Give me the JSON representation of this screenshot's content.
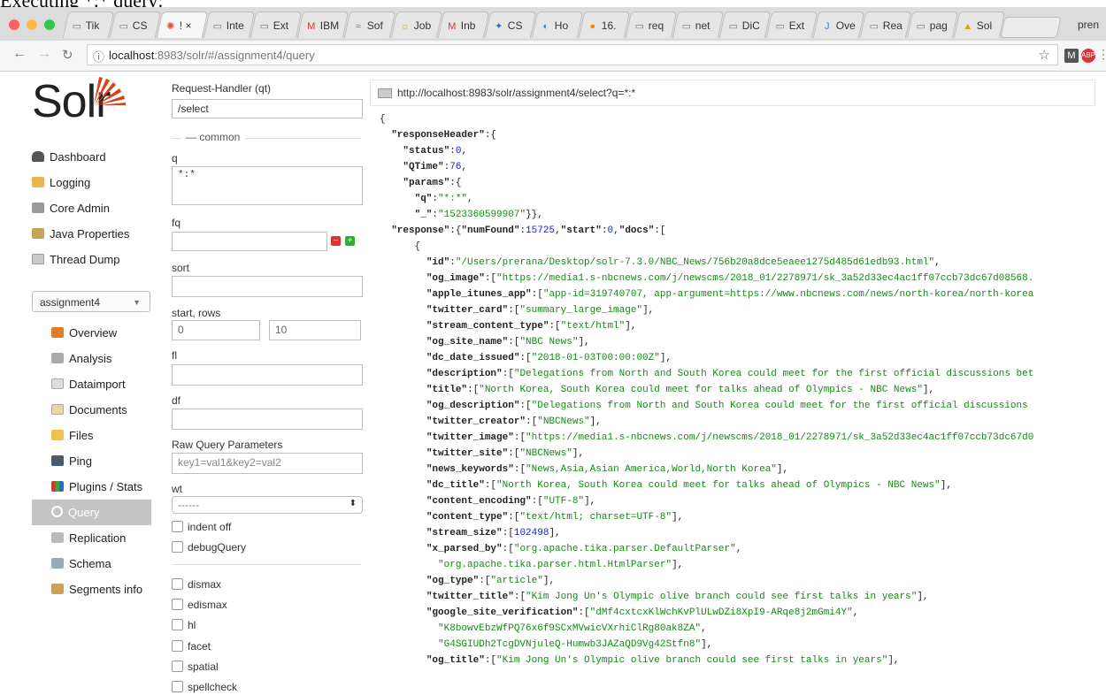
{
  "caption": "Executing *:* query:",
  "browser": {
    "tabs": [
      "Tik",
      "CS",
      "! ×",
      "Inte",
      "Ext",
      "IBM",
      "Sof",
      "Job",
      "Inb",
      "CS",
      "Ho",
      "16.",
      "req",
      "net",
      "DiC",
      "Ext",
      "Ove",
      "Rea",
      "pag",
      "Sol"
    ],
    "profile": "pren",
    "url_host": "localhost",
    "url_rest": ":8983/solr/#/assignment4/query"
  },
  "app": {
    "logo": "Solr",
    "nav": [
      "Dashboard",
      "Logging",
      "Core Admin",
      "Java Properties",
      "Thread Dump"
    ],
    "core": "assignment4",
    "core_nav": [
      "Overview",
      "Analysis",
      "Dataimport",
      "Documents",
      "Files",
      "Ping",
      "Plugins / Stats",
      "Query",
      "Replication",
      "Schema",
      "Segments info"
    ],
    "active_core_nav": "Query"
  },
  "form": {
    "request_handler_label": "Request-Handler (qt)",
    "request_handler_value": "/select",
    "common_legend": "common",
    "q_label": "q",
    "q_value": "*:*",
    "fq_label": "fq",
    "sort_label": "sort",
    "start_rows_label": "start, rows",
    "start_value": "0",
    "rows_value": "10",
    "fl_label": "fl",
    "df_label": "df",
    "raw_label": "Raw Query Parameters",
    "raw_placeholder": "key1=val1&key2=val2",
    "wt_label": "wt",
    "wt_value": "------",
    "indent_label": "indent off",
    "debug_label": "debugQuery",
    "dismax_label": "dismax",
    "edismax_label": "edismax",
    "hl_label": "hl",
    "facet_label": "facet",
    "spatial_label": "spatial",
    "spellcheck_label": "spellcheck"
  },
  "response": {
    "request_url": "http://localhost:8983/solr/assignment4/select?q=*:*",
    "lines": [
      [
        [
          "p",
          "{"
        ]
      ],
      [
        [
          "p",
          "  "
        ],
        [
          "k",
          "\"responseHeader\""
        ],
        [
          "p",
          ":{"
        ]
      ],
      [
        [
          "p",
          "    "
        ],
        [
          "k",
          "\"status\""
        ],
        [
          "p",
          ":"
        ],
        [
          "n",
          "0"
        ],
        [
          "p",
          ","
        ]
      ],
      [
        [
          "p",
          "    "
        ],
        [
          "k",
          "\"QTime\""
        ],
        [
          "p",
          ":"
        ],
        [
          "n",
          "76"
        ],
        [
          "p",
          ","
        ]
      ],
      [
        [
          "p",
          "    "
        ],
        [
          "k",
          "\"params\""
        ],
        [
          "p",
          ":{"
        ]
      ],
      [
        [
          "p",
          "      "
        ],
        [
          "k",
          "\"q\""
        ],
        [
          "p",
          ":"
        ],
        [
          "s",
          "\"*:*\""
        ],
        [
          "p",
          ","
        ]
      ],
      [
        [
          "p",
          "      "
        ],
        [
          "k",
          "\"_\""
        ],
        [
          "p",
          ":"
        ],
        [
          "s",
          "\"1523360599907\""
        ],
        [
          "p",
          "}},"
        ]
      ],
      [
        [
          "p",
          "  "
        ],
        [
          "k",
          "\"response\""
        ],
        [
          "p",
          ":{"
        ],
        [
          "k",
          "\"numFound\""
        ],
        [
          "p",
          ":"
        ],
        [
          "n",
          "15725"
        ],
        [
          "p",
          ","
        ],
        [
          "k",
          "\"start\""
        ],
        [
          "p",
          ":"
        ],
        [
          "n",
          "0"
        ],
        [
          "p",
          ","
        ],
        [
          "k",
          "\"docs\""
        ],
        [
          "p",
          ":["
        ]
      ],
      [
        [
          "p",
          "      {"
        ]
      ],
      [
        [
          "p",
          "        "
        ],
        [
          "k",
          "\"id\""
        ],
        [
          "p",
          ":"
        ],
        [
          "s",
          "\"/Users/prerana/Desktop/solr-7.3.0/NBC_News/756b20a8dce5eaee1275d485d61edb93.html\""
        ],
        [
          "p",
          ","
        ]
      ],
      [
        [
          "p",
          "        "
        ],
        [
          "k",
          "\"og_image\""
        ],
        [
          "p",
          ":["
        ],
        [
          "s",
          "\"https://media1.s-nbcnews.com/j/newscms/2018_01/2278971/sk_3a52d33ec4ac1ff07ccb73dc67d08568."
        ]
      ],
      [
        [
          "p",
          "        "
        ],
        [
          "k",
          "\"apple_itunes_app\""
        ],
        [
          "p",
          ":["
        ],
        [
          "s",
          "\"app-id=319740707, app-argument=https://www.nbcnews.com/news/north-korea/north-korea"
        ]
      ],
      [
        [
          "p",
          "        "
        ],
        [
          "k",
          "\"twitter_card\""
        ],
        [
          "p",
          ":["
        ],
        [
          "s",
          "\"summary_large_image\""
        ],
        [
          "p",
          "],"
        ]
      ],
      [
        [
          "p",
          "        "
        ],
        [
          "k",
          "\"stream_content_type\""
        ],
        [
          "p",
          ":["
        ],
        [
          "s",
          "\"text/html\""
        ],
        [
          "p",
          "],"
        ]
      ],
      [
        [
          "p",
          "        "
        ],
        [
          "k",
          "\"og_site_name\""
        ],
        [
          "p",
          ":["
        ],
        [
          "s",
          "\"NBC News\""
        ],
        [
          "p",
          "],"
        ]
      ],
      [
        [
          "p",
          "        "
        ],
        [
          "k",
          "\"dc_date_issued\""
        ],
        [
          "p",
          ":["
        ],
        [
          "s",
          "\"2018-01-03T00:00:00Z\""
        ],
        [
          "p",
          "],"
        ]
      ],
      [
        [
          "p",
          "        "
        ],
        [
          "k",
          "\"description\""
        ],
        [
          "p",
          ":["
        ],
        [
          "s",
          "\"Delegations from North and South Korea could meet for the first official discussions bet"
        ]
      ],
      [
        [
          "p",
          "        "
        ],
        [
          "k",
          "\"title\""
        ],
        [
          "p",
          ":["
        ],
        [
          "s",
          "\"North Korea, South Korea could meet for talks ahead of Olympics - NBC News\""
        ],
        [
          "p",
          "],"
        ]
      ],
      [
        [
          "p",
          "        "
        ],
        [
          "k",
          "\"og_description\""
        ],
        [
          "p",
          ":["
        ],
        [
          "s",
          "\"Delegations from North and South Korea could meet for the first official discussions"
        ]
      ],
      [
        [
          "p",
          "        "
        ],
        [
          "k",
          "\"twitter_creator\""
        ],
        [
          "p",
          ":["
        ],
        [
          "s",
          "\"NBCNews\""
        ],
        [
          "p",
          "],"
        ]
      ],
      [
        [
          "p",
          "        "
        ],
        [
          "k",
          "\"twitter_image\""
        ],
        [
          "p",
          ":["
        ],
        [
          "s",
          "\"https://media1.s-nbcnews.com/j/newscms/2018_01/2278971/sk_3a52d33ec4ac1ff07ccb73dc67d0"
        ]
      ],
      [
        [
          "p",
          "        "
        ],
        [
          "k",
          "\"twitter_site\""
        ],
        [
          "p",
          ":["
        ],
        [
          "s",
          "\"NBCNews\""
        ],
        [
          "p",
          "],"
        ]
      ],
      [
        [
          "p",
          "        "
        ],
        [
          "k",
          "\"news_keywords\""
        ],
        [
          "p",
          ":["
        ],
        [
          "s",
          "\"News,Asia,Asian America,World,North Korea\""
        ],
        [
          "p",
          "],"
        ]
      ],
      [
        [
          "p",
          "        "
        ],
        [
          "k",
          "\"dc_title\""
        ],
        [
          "p",
          ":["
        ],
        [
          "s",
          "\"North Korea, South Korea could meet for talks ahead of Olympics - NBC News\""
        ],
        [
          "p",
          "],"
        ]
      ],
      [
        [
          "p",
          "        "
        ],
        [
          "k",
          "\"content_encoding\""
        ],
        [
          "p",
          ":["
        ],
        [
          "s",
          "\"UTF-8\""
        ],
        [
          "p",
          "],"
        ]
      ],
      [
        [
          "p",
          "        "
        ],
        [
          "k",
          "\"content_type\""
        ],
        [
          "p",
          ":["
        ],
        [
          "s",
          "\"text/html; charset=UTF-8\""
        ],
        [
          "p",
          "],"
        ]
      ],
      [
        [
          "p",
          "        "
        ],
        [
          "k",
          "\"stream_size\""
        ],
        [
          "p",
          ":["
        ],
        [
          "n",
          "102498"
        ],
        [
          "p",
          "],"
        ]
      ],
      [
        [
          "p",
          "        "
        ],
        [
          "k",
          "\"x_parsed_by\""
        ],
        [
          "p",
          ":["
        ],
        [
          "s",
          "\"org.apache.tika.parser.DefaultParser\""
        ],
        [
          "p",
          ","
        ]
      ],
      [
        [
          "p",
          "          "
        ],
        [
          "s",
          "\"org.apache.tika.parser.html.HtmlParser\""
        ],
        [
          "p",
          "],"
        ]
      ],
      [
        [
          "p",
          "        "
        ],
        [
          "k",
          "\"og_type\""
        ],
        [
          "p",
          ":["
        ],
        [
          "s",
          "\"article\""
        ],
        [
          "p",
          "],"
        ]
      ],
      [
        [
          "p",
          "        "
        ],
        [
          "k",
          "\"twitter_title\""
        ],
        [
          "p",
          ":["
        ],
        [
          "s",
          "\"Kim Jong Un's Olympic olive branch could see first talks in years\""
        ],
        [
          "p",
          "],"
        ]
      ],
      [
        [
          "p",
          "        "
        ],
        [
          "k",
          "\"google_site_verification\""
        ],
        [
          "p",
          ":["
        ],
        [
          "s",
          "\"dMf4cxtcxKlWchKvPlULwDZi8XpI9-ARqe8j2mGmi4Y\""
        ],
        [
          "p",
          ","
        ]
      ],
      [
        [
          "p",
          "          "
        ],
        [
          "s",
          "\"K8bowvEbzWfPQ76x6f9SCxMVwicVXrhiClRg80ak8ZA\""
        ],
        [
          "p",
          ","
        ]
      ],
      [
        [
          "p",
          "          "
        ],
        [
          "s",
          "\"G4SGIUDh2TcgDVNjuleQ-Humwb3JAZaQD9Vg42Stfn8\""
        ],
        [
          "p",
          "],"
        ]
      ],
      [
        [
          "p",
          "        "
        ],
        [
          "k",
          "\"og_title\""
        ],
        [
          "p",
          ":["
        ],
        [
          "s",
          "\"Kim Jong Un's Olympic olive branch could see first talks in years\""
        ],
        [
          "p",
          "],"
        ]
      ]
    ]
  }
}
